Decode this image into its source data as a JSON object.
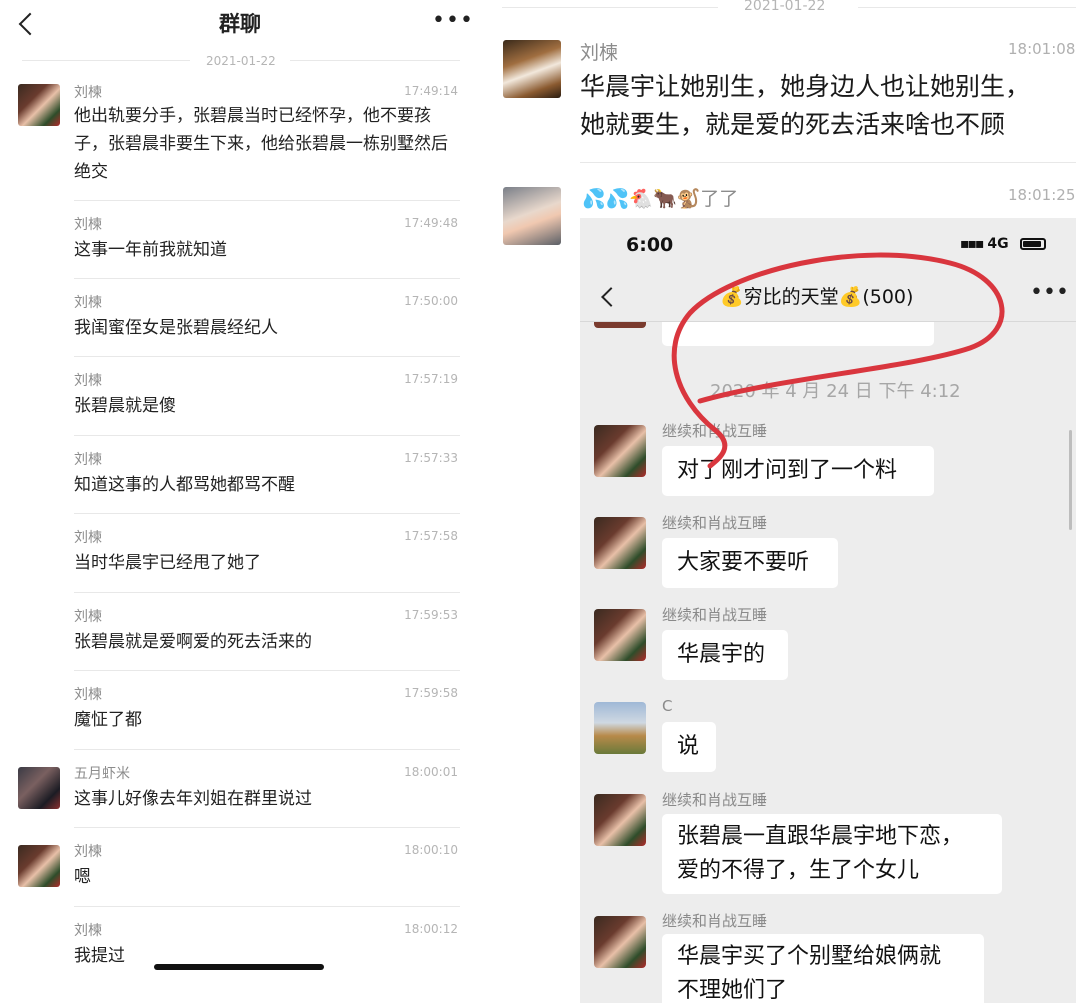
{
  "left": {
    "title": "群聊",
    "more_icon": "more-dots-icon",
    "date": "2021-01-22",
    "messages": [
      {
        "name": "刘楝",
        "time": "17:49:14",
        "text": "他出轨要分手，张碧晨当时已经怀孕，他不要孩子，张碧晨非要生下来，他给张碧晨一栋别墅然后绝交"
      },
      {
        "name": "刘楝",
        "time": "17:49:48",
        "text": "这事一年前我就知道"
      },
      {
        "name": "刘楝",
        "time": "17:50:00",
        "text": "我闺蜜侄女是张碧晨经纪人"
      },
      {
        "name": "刘楝",
        "time": "17:57:19",
        "text": "张碧晨就是傻"
      },
      {
        "name": "刘楝",
        "time": "17:57:33",
        "text": "知道这事的人都骂她都骂不醒"
      },
      {
        "name": "刘楝",
        "time": "17:57:58",
        "text": "当时华晨宇已经甩了她了"
      },
      {
        "name": "刘楝",
        "time": "17:59:53",
        "text": "张碧晨就是爱啊爱的死去活来的"
      },
      {
        "name": "刘楝",
        "time": "17:59:58",
        "text": "魔怔了都"
      },
      {
        "name": "五月虾米",
        "time": "18:00:01",
        "text": "这事儿好像去年刘姐在群里说过"
      },
      {
        "name": "刘楝",
        "time": "18:00:10",
        "text": "嗯"
      },
      {
        "name": "刘楝",
        "time": "18:00:12",
        "text": "我提过"
      }
    ]
  },
  "right": {
    "date": "2021-01-22",
    "msg1": {
      "name": "刘楝",
      "time": "18:01:08",
      "text_line1": "华晨宇让她别生，她身边人也让她别生，",
      "text_line2": "她就要生，就是爱的死去活来啥也不顾"
    },
    "msg2": {
      "name": "💦💦🐔🐂🐒了了",
      "time": "18:01:25"
    },
    "phone": {
      "status_time": "6:00",
      "network": "4G",
      "group_title": "💰穷比的天堂💰(500)",
      "date_stamp": "2020 年 4 月 24 日 下午 4:12",
      "messages": [
        {
          "name": "继续和肖战互睡",
          "text": "对了刚才问到了一个料"
        },
        {
          "name": "继续和肖战互睡",
          "text": "大家要不要听"
        },
        {
          "name": "继续和肖战互睡",
          "text": "华晨宇的"
        },
        {
          "name": "C",
          "text": "说"
        },
        {
          "name": "继续和肖战互睡",
          "text_line1": "张碧晨一直跟华晨宇地下恋，",
          "text_line2": "爱的不得了，生了个女儿"
        },
        {
          "name": "继续和肖战互睡",
          "text_line1": "华晨宇买了个别墅给娘俩就",
          "text_line2": "不理她们了"
        }
      ],
      "annotation_color": "#d9363e"
    }
  }
}
